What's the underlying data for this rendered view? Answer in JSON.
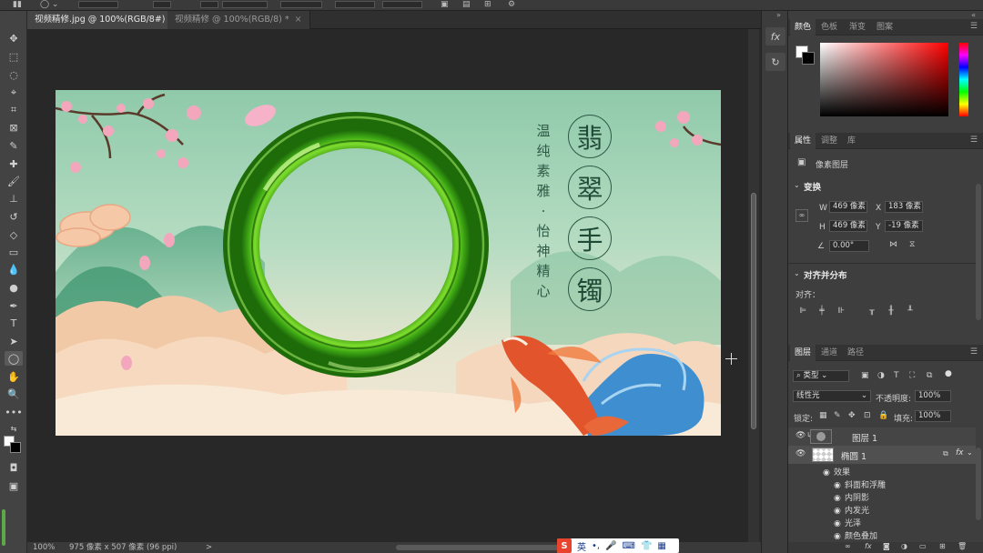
{
  "tabs": [
    {
      "label": "视频精修.jpg @ 100%(RGB/8#) *",
      "active": true
    },
    {
      "label": "视频精修 @ 100%(RGB/8) *",
      "active": false
    }
  ],
  "tab_close": "×",
  "artwork": {
    "slogan": [
      "温",
      "纯",
      "素",
      "雅",
      "·",
      "怡",
      "神",
      "精",
      "心"
    ],
    "title": [
      "翡",
      "翠",
      "手",
      "镯"
    ]
  },
  "color_panel": {
    "tabs": [
      "颜色",
      "色板",
      "渐变",
      "图案"
    ],
    "foreground": "#ffffff",
    "background": "#000000",
    "hue": "#ff0000"
  },
  "properties": {
    "tabs": [
      "属性",
      "调整",
      "库"
    ],
    "layer_kind": "像素图层",
    "transform_title": "变换",
    "w_label": "W",
    "w_value": "469 像素",
    "x_label": "X",
    "x_value": "183 像素",
    "h_label": "H",
    "h_value": "469 像素",
    "y_label": "Y",
    "y_value": "-19 像素",
    "angle_value": "0.00°",
    "align_title": "对齐并分布",
    "align_label": "对齐："
  },
  "layers": {
    "tabs": [
      "图层",
      "通道",
      "路径"
    ],
    "filter_kind": "类型",
    "blend_mode": "线性光",
    "opacity_label": "不透明度:",
    "opacity_value": "100%",
    "lock_label": "锁定:",
    "fill_label": "填充:",
    "fill_value": "100%",
    "items": [
      {
        "name": "图层 1",
        "clipped": true
      },
      {
        "name": "椭圆 1",
        "fx": "fx"
      }
    ],
    "effects_label": "效果",
    "effects": [
      "斜面和浮雕",
      "内阴影",
      "内发光",
      "光泽",
      "颜色叠加"
    ]
  },
  "status": {
    "zoom": "100%",
    "doc_size": "975 像素 x 507 像素 (96 ppi)",
    "arrow": ">"
  },
  "ime": {
    "logo": "S",
    "lang": "英"
  }
}
